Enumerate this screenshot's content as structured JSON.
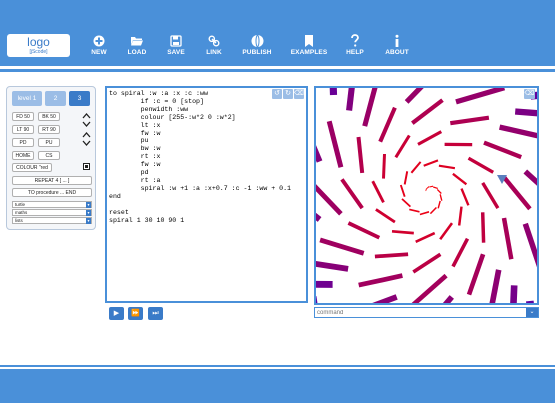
{
  "logo": {
    "main": "logo",
    "sub": "[jScode]"
  },
  "nav": [
    {
      "icon": "plus-circle-icon",
      "label": "NEW"
    },
    {
      "icon": "folder-open-icon",
      "label": "LOAD"
    },
    {
      "icon": "floppy-disk-icon",
      "label": "SAVE"
    },
    {
      "icon": "link-icon",
      "label": "LINK"
    },
    {
      "icon": "globe-icon",
      "label": "PUBLISH"
    },
    {
      "icon": "bookmark-icon",
      "label": "EXAMPLES"
    },
    {
      "icon": "question-icon",
      "label": "HELP"
    },
    {
      "icon": "info-icon",
      "label": "ABOUT"
    }
  ],
  "palette": {
    "levels": [
      "level 1",
      "2",
      "3"
    ],
    "commands": {
      "fd": "FD 50",
      "bk": "BK 50",
      "lt": "LT 90",
      "rt": "RT 90",
      "pd": "PD",
      "pu": "PU",
      "home": "HOME",
      "cs": "CS",
      "colour": "COLOUR \"red",
      "repeat": "REPEAT 4 [ ... ]",
      "procedure": "TO procedure ... END"
    },
    "lists": [
      "turtle",
      "maths",
      "lists"
    ]
  },
  "editor": {
    "code": "to spiral :w :a :x :c :ww\n        if :c = 0 [stop]\n        penwidth :ww\n        colour [255-:w*2 0 :w*2]\n        lt :x\n        fw :w\n        pu\n        bw :w\n        rt :x\n        fw :w\n        pd\n        rt :a\n        spiral :w +1 :a :x+0.7 :c -1 :ww + 0.1\nend\n\nreset\nspiral 1 30 10 90 1",
    "tools": {
      "undo": "↺",
      "redo": "↻",
      "clear": "⌫"
    }
  },
  "run": {
    "play": "▶",
    "fast": "⏩",
    "skip": "⏭"
  },
  "canvas": {
    "clear": "⌫"
  },
  "command": {
    "placeholder": "command",
    "arrow": "⌄"
  },
  "colors": {
    "accent": "#4a90d9",
    "button": "#3a7bc8",
    "tab_inactive": "#9bbde6"
  }
}
